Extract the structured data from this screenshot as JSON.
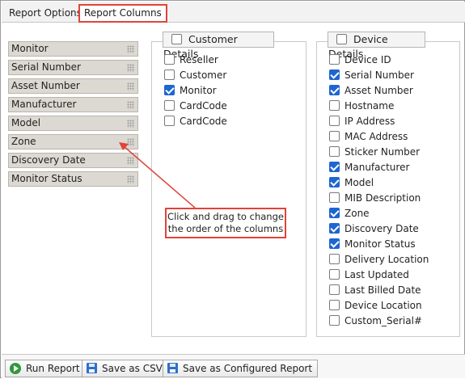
{
  "tabs": [
    {
      "label": "Report Options"
    },
    {
      "label": "Report Columns"
    }
  ],
  "selected_columns": [
    "Monitor",
    "Serial Number",
    "Asset Number",
    "Manufacturer",
    "Model",
    "Zone",
    "Discovery Date",
    "Monitor Status"
  ],
  "callout": {
    "line1": "Click and drag to change",
    "line2": "the order of the columns"
  },
  "customer_details": {
    "title": "Customer Details",
    "header_checked": false,
    "options": [
      {
        "label": "Reseller",
        "checked": false
      },
      {
        "label": "Customer",
        "checked": false
      },
      {
        "label": "Monitor",
        "checked": true
      },
      {
        "label": "CardCode",
        "checked": false
      },
      {
        "label": "CardCode",
        "checked": false
      }
    ]
  },
  "device_details": {
    "title": "Device Details",
    "header_checked": false,
    "options": [
      {
        "label": "Device ID",
        "checked": false
      },
      {
        "label": "Serial Number",
        "checked": true
      },
      {
        "label": "Asset Number",
        "checked": true
      },
      {
        "label": "Hostname",
        "checked": false
      },
      {
        "label": "IP Address",
        "checked": false
      },
      {
        "label": "MAC Address",
        "checked": false
      },
      {
        "label": "Sticker Number",
        "checked": false
      },
      {
        "label": "Manufacturer",
        "checked": true
      },
      {
        "label": "Model",
        "checked": true
      },
      {
        "label": "MIB Description",
        "checked": false
      },
      {
        "label": "Zone",
        "checked": true
      },
      {
        "label": "Discovery Date",
        "checked": true
      },
      {
        "label": "Monitor Status",
        "checked": true
      },
      {
        "label": "Delivery Location",
        "checked": false
      },
      {
        "label": "Last Updated",
        "checked": false
      },
      {
        "label": "Last Billed Date",
        "checked": false
      },
      {
        "label": "Device Location",
        "checked": false
      },
      {
        "label": "Custom_Serial#",
        "checked": false
      }
    ]
  },
  "buttons": {
    "run": {
      "label": "Run Report",
      "icon": "play-icon"
    },
    "csv": {
      "label": "Save as CSV",
      "icon": "save-icon"
    },
    "configured": {
      "label": "Save as Configured Report",
      "icon": "save-icon"
    }
  },
  "colors": {
    "highlight": "#e0443a",
    "checkbox": "#1e66d0",
    "chip": "#dcd9d3"
  }
}
